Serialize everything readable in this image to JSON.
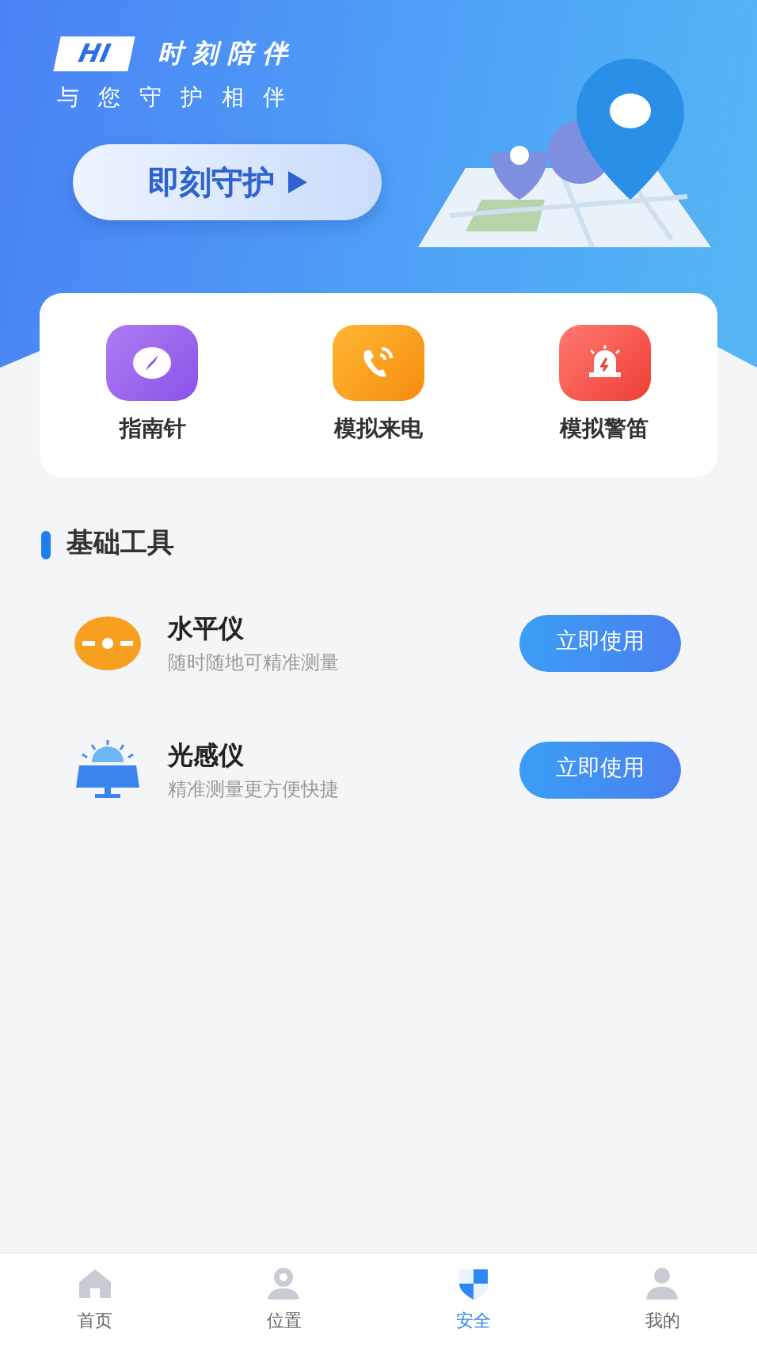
{
  "banner": {
    "tag": "HI",
    "title": "时刻陪伴",
    "subtitle": "与您守护相伴",
    "button": "即刻守护"
  },
  "quick_actions": [
    {
      "label": "指南针",
      "kind": "compass"
    },
    {
      "label": "模拟来电",
      "kind": "call"
    },
    {
      "label": "模拟警笛",
      "kind": "siren"
    }
  ],
  "section_title": "基础工具",
  "tools": [
    {
      "kind": "level",
      "name": "水平仪",
      "description": "随时随地可精准测量",
      "button": "立即使用"
    },
    {
      "kind": "light",
      "name": "光感仪",
      "description": "精准测量更方便快捷",
      "button": "立即使用"
    }
  ],
  "tabs": [
    {
      "kind": "home",
      "label": "首页",
      "selected": false
    },
    {
      "kind": "location",
      "label": "位置",
      "selected": false
    },
    {
      "kind": "shield",
      "label": "安全",
      "selected": true
    },
    {
      "kind": "user",
      "label": "我的",
      "selected": false
    }
  ]
}
